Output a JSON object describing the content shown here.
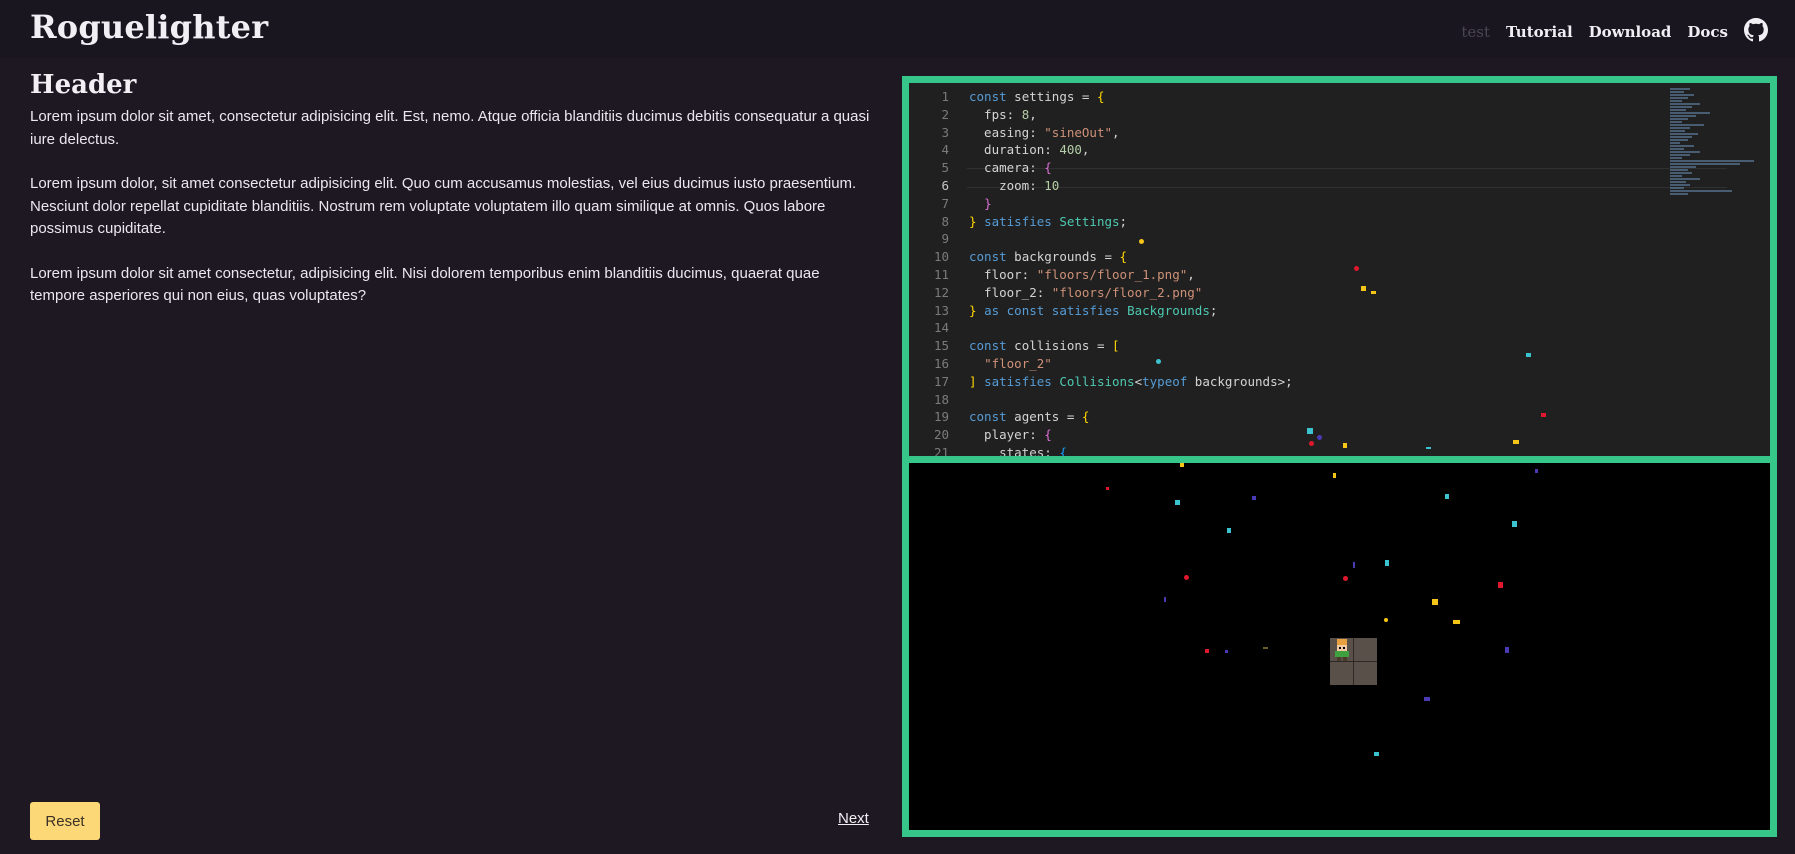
{
  "brand": "Roguelighter",
  "nav": {
    "test_label": "test",
    "tutorial_label": "Tutorial",
    "download_label": "Download",
    "docs_label": "Docs",
    "github_icon": "github-icon"
  },
  "content": {
    "header": "Header",
    "paragraphs": [
      "Lorem ipsum dolor sit amet, consectetur adipisicing elit. Est, nemo. Atque officia blanditiis ducimus debitis consequatur a quasi iure delectus.",
      "Lorem ipsum dolor, sit amet consectetur adipisicing elit. Quo cum accusamus molestias, vel eius ducimus iusto praesentium. Nesciunt dolor repellat cupiditate blanditiis. Nostrum rem voluptate voluptatem illo quam similique at omnis. Quos labore possimus cupiditate.",
      "Lorem ipsum dolor sit amet consectetur, adipisicing elit. Nisi dolorem temporibus enim blanditiis ducimus, quaerat quae tempore asperiores qui non eius, quas voluptates?"
    ]
  },
  "buttons": {
    "reset_label": "Reset",
    "next_label": "Next"
  },
  "editor": {
    "line_numbers": [
      "1",
      "2",
      "3",
      "4",
      "5",
      "6",
      "7",
      "8",
      "9",
      "10",
      "11",
      "12",
      "13",
      "14",
      "15",
      "16",
      "17",
      "18",
      "19",
      "20",
      "21"
    ],
    "current_line": "6"
  },
  "colors": {
    "accent_frame": "#36c68a",
    "background": "#1d1822",
    "reset_button": "#fcd877"
  }
}
